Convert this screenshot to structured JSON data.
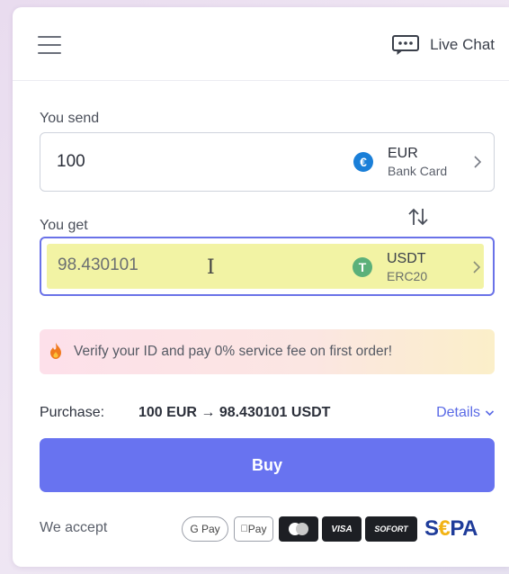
{
  "header": {
    "menu_icon": "hamburger-icon",
    "chat_icon": "chat-bubble-icon",
    "live_chat_label": "Live Chat"
  },
  "send": {
    "label": "You send",
    "amount": "100",
    "currency_code": "EUR",
    "currency_method": "Bank Card",
    "coin_symbol": "€",
    "coin_color": "#1a7fd8"
  },
  "swap_icon": "swap-arrows-icon",
  "get": {
    "label": "You get",
    "amount": "98.430101",
    "currency_code": "USDT",
    "currency_network": "ERC20",
    "coin_symbol": "T",
    "coin_color": "#5bb07a"
  },
  "banner": {
    "icon": "fire-icon",
    "text": "Verify your ID and pay 0% service fee on first order!"
  },
  "purchase": {
    "label": "Purchase:",
    "value": "100 EUR → 98.430101 USDT",
    "details_label": "Details"
  },
  "buy_label": "Buy",
  "accept": {
    "label": "We accept",
    "methods": [
      "G Pay",
      "Pay",
      "SOFORT",
      "VISA",
      "S",
      "€",
      "PA"
    ]
  },
  "colors": {
    "accent": "#6873f0",
    "link": "#5a6ae6",
    "highlight": "#f2f3a4"
  }
}
